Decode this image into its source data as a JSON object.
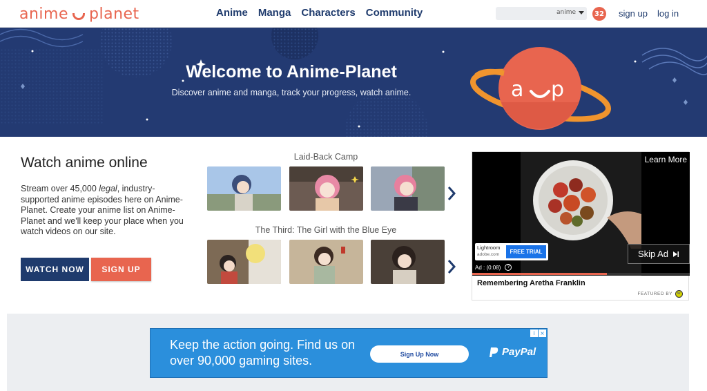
{
  "header": {
    "logo_left": "anime",
    "logo_right": "planet",
    "nav": [
      "Anime",
      "Manga",
      "Characters",
      "Community"
    ],
    "search_type": "anime",
    "notification_count": "32",
    "sign_up": "sign up",
    "log_in": "log in",
    "brand_color": "#e8654f",
    "nav_color": "#1f3b6d"
  },
  "hero": {
    "title": "Welcome to Anime-Planet",
    "subtitle": "Discover anime and manga, track your progress, watch anime.",
    "background": "#233a72"
  },
  "watch": {
    "title": "Watch anime online",
    "desc_pre": "Stream over 45,000 ",
    "desc_em": "legal",
    "desc_post": ", industry-supported anime episodes here on Anime-Planet. Create your anime list on Anime-Planet and we'll keep your place when you watch videos on our site.",
    "watch_now": "WATCH NOW",
    "sign_up": "SIGN UP"
  },
  "carousels": [
    {
      "title": "Laid-Back Camp"
    },
    {
      "title": "The Third: The Girl with the Blue Eye"
    }
  ],
  "video_ad": {
    "learn_more": "Learn More",
    "skip_ad": "Skip Ad",
    "lightroom_brand": "Lightroom",
    "lightroom_url": "adobe.com",
    "free_trial": "FREE TRIAL",
    "timer": "Ad : (0:08)",
    "caption": "Remembering Aretha Franklin",
    "featured_by": "FEATURED BY",
    "progress_fraction": 0.62
  },
  "banner_ad": {
    "text": "Keep the action going. Find us on over 90,000 gaming sites.",
    "button": "Sign Up Now",
    "brand": "PayPal"
  }
}
